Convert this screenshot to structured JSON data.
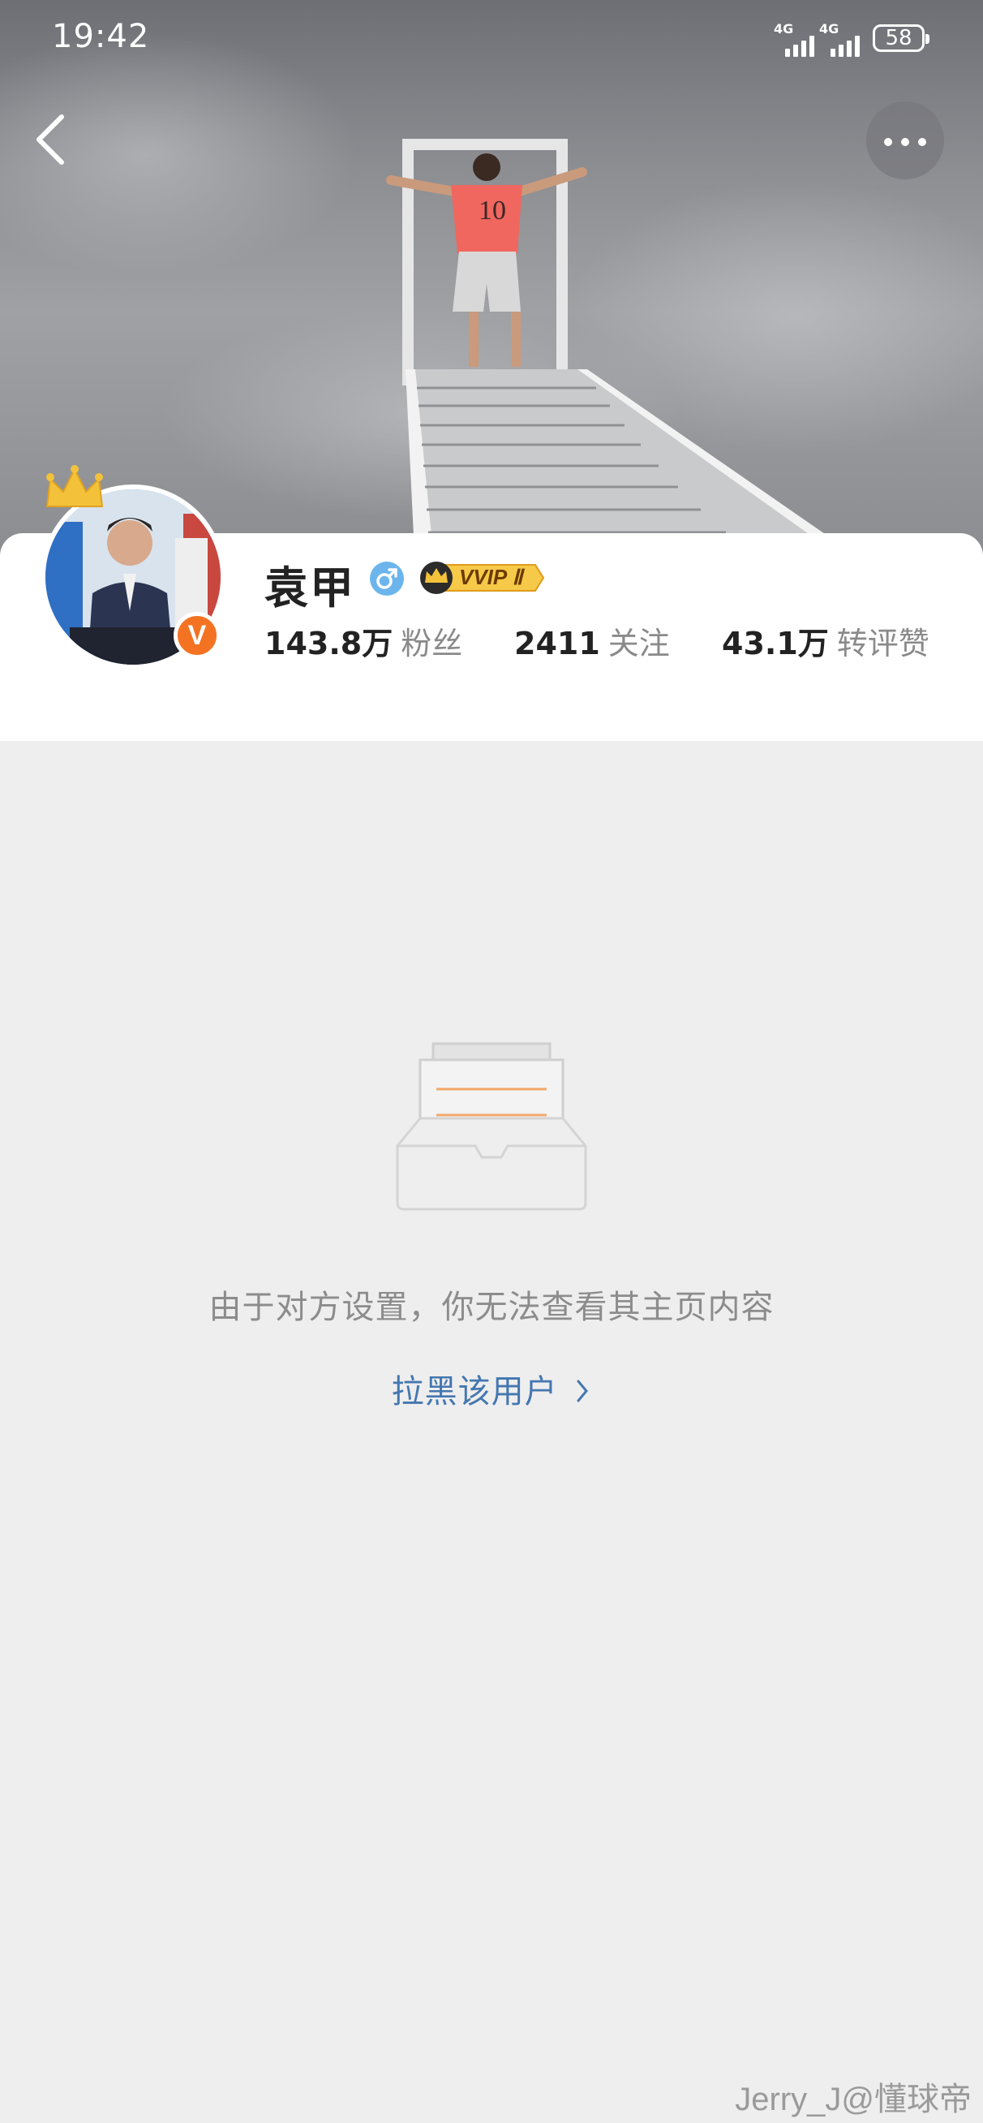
{
  "status_bar": {
    "time": "19:42",
    "network_1": "4G",
    "network_2": "4G",
    "battery": "58"
  },
  "profile": {
    "name": "袁甲",
    "gender_symbol": "♂",
    "vip_badge": "VVIP Ⅱ",
    "verified_badge": "V",
    "stats": [
      {
        "value": "143.8万",
        "label": "粉丝"
      },
      {
        "value": "2411",
        "label": "关注"
      },
      {
        "value": "43.1万",
        "label": "转评赞"
      }
    ]
  },
  "empty_state": {
    "message": "由于对方设置，你无法查看其主页内容",
    "block_link": "拉黑该用户"
  },
  "watermark": "Jerry_J@懂球帝",
  "icons": {
    "back": "back-arrow-icon",
    "more": "more-dots-icon",
    "empty": "empty-inbox-icon",
    "chevron": "chevron-right-icon"
  },
  "colors": {
    "link": "#4477b0",
    "verified": "#f37323",
    "gender": "#6cb5ec",
    "vip_gold": "#f3c23a"
  }
}
